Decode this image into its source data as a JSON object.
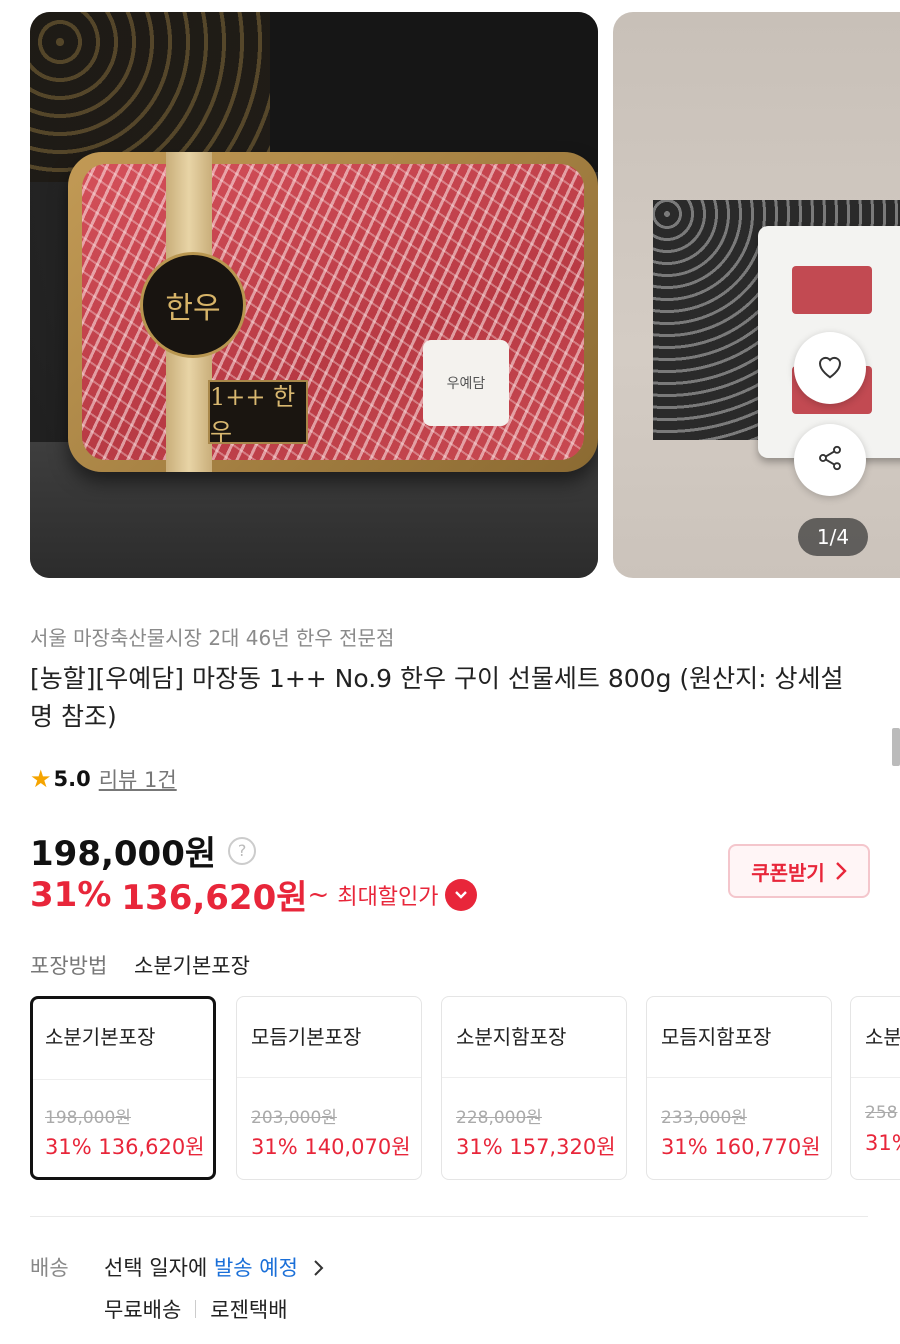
{
  "gallery": {
    "image1_brand_seal": "한우",
    "image1_grade_label": "1++ 한우",
    "image1_sticker": "우예담",
    "pager": "1/4"
  },
  "product": {
    "seller_tagline": "서울 마장축산물시장 2대 46년 한우 전문점",
    "title": "[농할][우예담] 마장동 1++ No.9 한우 구이 선물세트 800g (원산지: 상세설명 참조)",
    "rating_value": "5.0",
    "review_link": "리뷰 1건"
  },
  "price": {
    "original": "198,000원",
    "help_icon": "?",
    "discount_pct": "31%",
    "sale_price": "136,620원",
    "tilde": "~",
    "max_discount_label": "최대할인가",
    "coupon_button": "쿠폰받기"
  },
  "packaging": {
    "label": "포장방법",
    "selected": "소분기본포장",
    "options": [
      {
        "name": "소분기본포장",
        "original": "198,000원",
        "sale": "31% 136,620원"
      },
      {
        "name": "모듬기본포장",
        "original": "203,000원",
        "sale": "31% 140,070원"
      },
      {
        "name": "소분지함포장",
        "original": "228,000원",
        "sale": "31% 157,320원"
      },
      {
        "name": "모듬지함포장",
        "original": "233,000원",
        "sale": "31% 160,770원"
      },
      {
        "name": "소분",
        "original": "258",
        "sale": "31%"
      }
    ]
  },
  "shipping": {
    "label": "배송",
    "text_before": "선택 일자에 ",
    "highlight": "발송 예정",
    "free": "무료배송",
    "carrier": "로젠택배"
  },
  "colors": {
    "accent_red": "#e8263a",
    "link_blue": "#1a6fd8",
    "star": "#f5a400"
  },
  "icons": [
    "heart-icon",
    "share-icon",
    "star-icon",
    "chevron-right-icon",
    "chevron-down-icon",
    "help-icon"
  ]
}
